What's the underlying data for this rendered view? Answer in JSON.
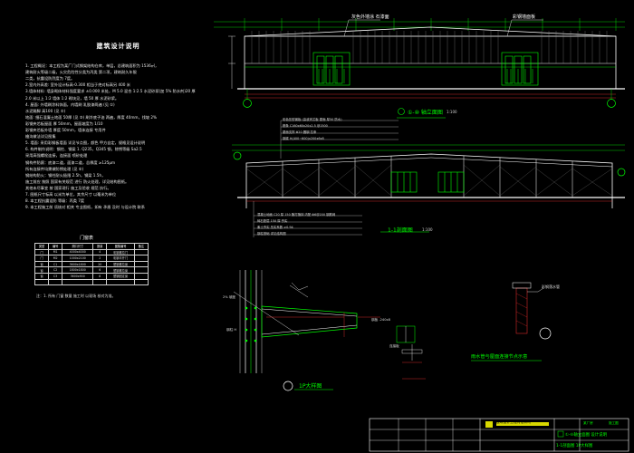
{
  "notes": {
    "title": "建筑设计说明",
    "lines": [
      "1. 工程概况：本工程为某厂门式钢架结构仓库，单层，总建筑面积为 1536㎡，",
      "   建筑耐火等级二级，火灾危险性分类为丙类 第二项，建筑耐久年限",
      "   二类，抗震设防烈度为 7度。",
      "2.室内外高差: 室外设计标高-0.300 相当于绝对标高另 400 米",
      "3.墙体材料: 墙身砌体材料强度要求 ±0.000 米处，M 5.0 混合 1:2.5 水泥砂浆(加 5% 防水剂)20 厚",
      "  2.0 米以上 1:2 墙体 1:2 砌块见，墙 50 厚 水泥砂浆。",
      "4. 屋面: 外墙刷涂料饰面，内墙刷 乳胶漆两遍 (见 ①)",
      "   水泥踢脚 高100 (见 ②)",
      "   地面: 细石混凝土地面 50厚 (见 ③) 刷冷底子油 两遍，厚度 40mm，找坡 2%",
      "   彩钢夹芯板屋面 厚 50mm，屋面坡度为 1/10",
      "   彩钢夹芯板外墙 厚度 50mm，墙体连接 专用件",
      "   檐沟做法详见图集",
      "5. 墙面: 采用彩钢板墙面 详见节点图，颜色 甲方自定，规格见设计说明",
      "6. 构件制作说明：钢柱、钢梁 1. Q235，Q345 钢，除锈等级 Sa2.5",
      "   采用高强螺栓连接，连接面 喷砂处理",
      "   钢构件防腐：底漆二道，面漆二道，总厚度 ≥125μm",
      "   所有连接件均需做防锈处理 (见 ⑤)",
      "   钢结构防火：钢柱耐火极限 2.5h，钢梁 1.5h，",
      "   施工前应 按照 国家有关规范 进行 防火处理，详见结构图纸。",
      "   其他未尽事宜 按 国家现行 施工及验收 规范 执行。",
      "7. 图纸尺寸标高 以米为单位，其余尺寸 以毫米为单位",
      "8. 本工程抗震设防 等级：丙类 7度",
      "9. 本工程施工前 须核对 相关 专业图纸，如有 矛盾 及时 与设计院 联系"
    ],
    "door_table": {
      "title": "门窗表",
      "header": [
        "类型",
        "编号",
        "洞口尺寸",
        "数量",
        "图集编号",
        "备注"
      ],
      "rows": [
        [
          "门",
          "M1",
          "4000x4000",
          "4",
          "彩钢推拉门",
          ""
        ],
        [
          "门",
          "M2",
          "1000x2100",
          "2",
          "彩钢平开门",
          ""
        ],
        [
          "窗",
          "C1",
          "3600x1800",
          "20",
          "塑钢推拉窗",
          ""
        ],
        [
          "窗",
          "C2",
          "1800x1800",
          "6",
          "塑钢推拉窗",
          ""
        ],
        [
          "窗",
          "C3",
          "3600x900",
          "8",
          "塑钢固定窗",
          ""
        ],
        [
          "",
          "",
          "",
          "",
          "",
          ""
        ]
      ],
      "note": "注：1. 所有 门窗 数量 施工时 以现场 核对为准。"
    }
  },
  "elevation_top": {
    "label_left": "灰色外墙涂 石漆面",
    "label_right": "彩钢墙面板",
    "title": "①-⑩ 轴立面图",
    "scale": "1:100"
  },
  "section": {
    "title": "1-1剖面图",
    "scale": "1:100",
    "roof_notes": [
      "彩色压型钢板 (高波夹芯板 屋面 厚50 防水)",
      "檩条 C160x60x20x2.5 @1500",
      "屋面支撑 Φ20 圆钢 拉条",
      "钢梁 H(400~600)x200x6x8"
    ],
    "floor_notes": [
      "混凝土地面 C20 厚 150 随打随抹 内配 Φ6@200 钢筋网",
      "碎石垫层 150 厚 夯实",
      "素土夯实 压实系数 ≥0.94",
      "钢柱基础 详见结构图"
    ]
  },
  "detail1": {
    "title": "1P大样图",
    "label_tl": "2% 坡度",
    "label_tr": "钢板 -240x8",
    "label_l": "钢柱 H",
    "label_r": "连接板"
  },
  "detail2": {
    "title": "雨水管与屋面连接节点示意",
    "label": "彩钢落水管"
  },
  "title_block": {
    "company": "建筑设计工程有限公司",
    "drawing_name_1": "①-⑩轴立面图  设计说明",
    "drawing_name_2": "1-1剖面图  1P大样图",
    "project": "某厂房",
    "stage": "施工图"
  },
  "colors": {
    "line": "#ffffff",
    "accent": "#00ff00",
    "dim": "#ff3030",
    "title_accent": "#d8d800"
  }
}
